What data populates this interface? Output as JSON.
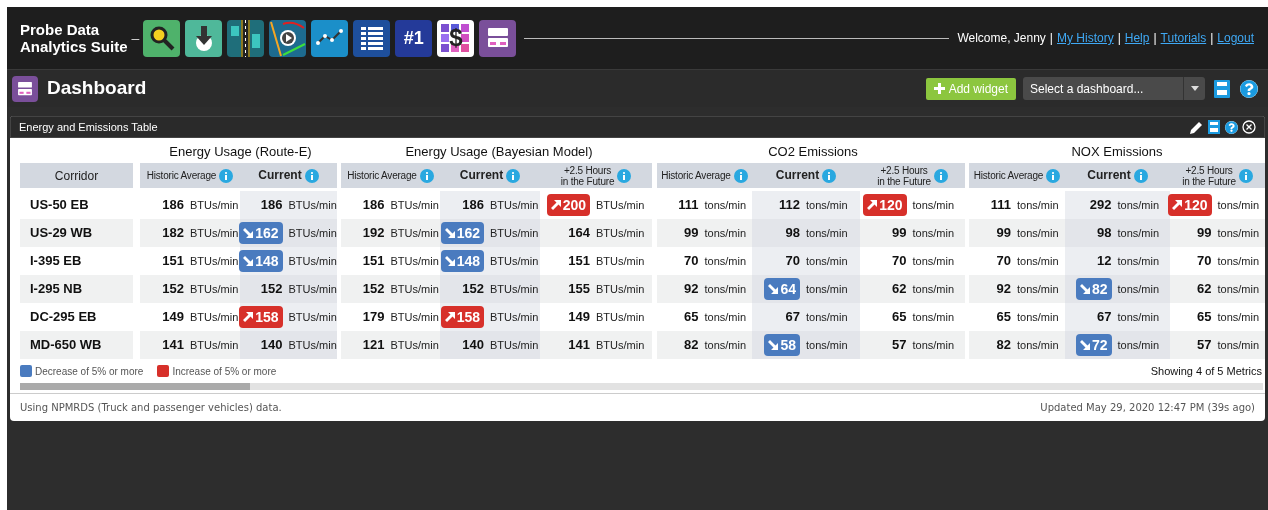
{
  "header": {
    "title_lines": [
      "Probe Data",
      "Analytics Suite"
    ],
    "separator": "–",
    "apps": [
      {
        "kind": "search"
      },
      {
        "kind": "download"
      },
      {
        "kind": "road"
      },
      {
        "kind": "map-play"
      },
      {
        "kind": "line-chart"
      },
      {
        "kind": "list"
      },
      {
        "kind": "rank",
        "label": "#1"
      },
      {
        "kind": "cost",
        "label": "$"
      },
      {
        "kind": "dashboard"
      }
    ],
    "welcome": "Welcome, Jenny",
    "links": [
      "My History",
      "Help",
      "Tutorials",
      "Logout"
    ],
    "link_separator": "|"
  },
  "page_bar": {
    "title": "Dashboard",
    "add_button": "Add widget",
    "select": {
      "placeholder": "Select a dashboard..."
    }
  },
  "widget": {
    "title": "Energy and Emissions Table",
    "corridor_header": "Corridor",
    "groups": [
      {
        "title": "Energy Usage (Route-E)",
        "columns": [
          {
            "lines": [
              "Historic Average"
            ],
            "emphasis": false
          },
          {
            "lines": [
              "Current"
            ],
            "emphasis": true
          }
        ]
      },
      {
        "title": "Energy Usage (Bayesian Model)",
        "columns": [
          {
            "lines": [
              "Historic Average"
            ],
            "emphasis": false
          },
          {
            "lines": [
              "Current"
            ],
            "emphasis": true
          },
          {
            "lines": [
              "+2.5 Hours",
              "in the Future"
            ],
            "emphasis": false
          }
        ]
      },
      {
        "title": "CO2 Emissions",
        "columns": [
          {
            "lines": [
              "Historic Average"
            ],
            "emphasis": false
          },
          {
            "lines": [
              "Current"
            ],
            "emphasis": true
          },
          {
            "lines": [
              "+2.5 Hours",
              "in the Future"
            ],
            "emphasis": false
          }
        ]
      },
      {
        "title": "NOX Emissions",
        "columns": [
          {
            "lines": [
              "Historic Average"
            ],
            "emphasis": false
          },
          {
            "lines": [
              "Current"
            ],
            "emphasis": true
          },
          {
            "lines": [
              "+2.5 Hours",
              "in the Future"
            ],
            "emphasis": false
          }
        ]
      }
    ],
    "rows": [
      {
        "corridor": "US-50 EB",
        "cells": [
          {
            "value": "186",
            "unit": "BTUs/min",
            "kind": "plain"
          },
          {
            "value": "186",
            "unit": "BTUs/min",
            "kind": "plain"
          },
          {
            "value": "186",
            "unit": "BTUs/min",
            "kind": "plain"
          },
          {
            "value": "186",
            "unit": "BTUs/min",
            "kind": "plain"
          },
          {
            "value": "200",
            "unit": "BTUs/min",
            "kind": "up"
          },
          {
            "value": "111",
            "unit": "tons/min",
            "kind": "plain"
          },
          {
            "value": "112",
            "unit": "tons/min",
            "kind": "plain"
          },
          {
            "value": "120",
            "unit": "tons/min",
            "kind": "up"
          },
          {
            "value": "111",
            "unit": "tons/min",
            "kind": "plain"
          },
          {
            "value": "292",
            "unit": "tons/min",
            "kind": "plain"
          },
          {
            "value": "120",
            "unit": "tons/min",
            "kind": "up"
          }
        ]
      },
      {
        "corridor": "US-29 WB",
        "cells": [
          {
            "value": "182",
            "unit": "BTUs/min",
            "kind": "plain"
          },
          {
            "value": "162",
            "unit": "BTUs/min",
            "kind": "down"
          },
          {
            "value": "192",
            "unit": "BTUs/min",
            "kind": "plain"
          },
          {
            "value": "162",
            "unit": "BTUs/min",
            "kind": "down"
          },
          {
            "value": "164",
            "unit": "BTUs/min",
            "kind": "plain"
          },
          {
            "value": "99",
            "unit": "tons/min",
            "kind": "plain"
          },
          {
            "value": "98",
            "unit": "tons/min",
            "kind": "plain"
          },
          {
            "value": "99",
            "unit": "tons/min",
            "kind": "plain"
          },
          {
            "value": "99",
            "unit": "tons/min",
            "kind": "plain"
          },
          {
            "value": "98",
            "unit": "tons/min",
            "kind": "plain"
          },
          {
            "value": "99",
            "unit": "tons/min",
            "kind": "plain"
          }
        ]
      },
      {
        "corridor": "I-395 EB",
        "cells": [
          {
            "value": "151",
            "unit": "BTUs/min",
            "kind": "plain"
          },
          {
            "value": "148",
            "unit": "BTUs/min",
            "kind": "down"
          },
          {
            "value": "151",
            "unit": "BTUs/min",
            "kind": "plain"
          },
          {
            "value": "148",
            "unit": "BTUs/min",
            "kind": "down"
          },
          {
            "value": "151",
            "unit": "BTUs/min",
            "kind": "plain"
          },
          {
            "value": "70",
            "unit": "tons/min",
            "kind": "plain"
          },
          {
            "value": "70",
            "unit": "tons/min",
            "kind": "plain"
          },
          {
            "value": "70",
            "unit": "tons/min",
            "kind": "plain"
          },
          {
            "value": "70",
            "unit": "tons/min",
            "kind": "plain"
          },
          {
            "value": "12",
            "unit": "tons/min",
            "kind": "plain"
          },
          {
            "value": "70",
            "unit": "tons/min",
            "kind": "plain"
          }
        ]
      },
      {
        "corridor": "I-295 NB",
        "cells": [
          {
            "value": "152",
            "unit": "BTUs/min",
            "kind": "plain"
          },
          {
            "value": "152",
            "unit": "BTUs/min",
            "kind": "plain"
          },
          {
            "value": "152",
            "unit": "BTUs/min",
            "kind": "plain"
          },
          {
            "value": "152",
            "unit": "BTUs/min",
            "kind": "plain"
          },
          {
            "value": "155",
            "unit": "BTUs/min",
            "kind": "plain"
          },
          {
            "value": "92",
            "unit": "tons/min",
            "kind": "plain"
          },
          {
            "value": "64",
            "unit": "tons/min",
            "kind": "down"
          },
          {
            "value": "62",
            "unit": "tons/min",
            "kind": "plain"
          },
          {
            "value": "92",
            "unit": "tons/min",
            "kind": "plain"
          },
          {
            "value": "82",
            "unit": "tons/min",
            "kind": "down"
          },
          {
            "value": "62",
            "unit": "tons/min",
            "kind": "plain"
          }
        ]
      },
      {
        "corridor": "DC-295 EB",
        "cells": [
          {
            "value": "149",
            "unit": "BTUs/min",
            "kind": "plain"
          },
          {
            "value": "158",
            "unit": "BTUs/min",
            "kind": "up"
          },
          {
            "value": "179",
            "unit": "BTUs/min",
            "kind": "plain"
          },
          {
            "value": "158",
            "unit": "BTUs/min",
            "kind": "up"
          },
          {
            "value": "149",
            "unit": "BTUs/min",
            "kind": "plain"
          },
          {
            "value": "65",
            "unit": "tons/min",
            "kind": "plain"
          },
          {
            "value": "67",
            "unit": "tons/min",
            "kind": "plain"
          },
          {
            "value": "65",
            "unit": "tons/min",
            "kind": "plain"
          },
          {
            "value": "65",
            "unit": "tons/min",
            "kind": "plain"
          },
          {
            "value": "67",
            "unit": "tons/min",
            "kind": "plain"
          },
          {
            "value": "65",
            "unit": "tons/min",
            "kind": "plain"
          }
        ]
      },
      {
        "corridor": "MD-650 WB",
        "cells": [
          {
            "value": "141",
            "unit": "BTUs/min",
            "kind": "plain"
          },
          {
            "value": "140",
            "unit": "BTUs/min",
            "kind": "plain"
          },
          {
            "value": "121",
            "unit": "BTUs/min",
            "kind": "plain"
          },
          {
            "value": "140",
            "unit": "BTUs/min",
            "kind": "plain"
          },
          {
            "value": "141",
            "unit": "BTUs/min",
            "kind": "plain"
          },
          {
            "value": "82",
            "unit": "tons/min",
            "kind": "plain"
          },
          {
            "value": "58",
            "unit": "tons/min",
            "kind": "down"
          },
          {
            "value": "57",
            "unit": "tons/min",
            "kind": "plain"
          },
          {
            "value": "82",
            "unit": "tons/min",
            "kind": "plain"
          },
          {
            "value": "72",
            "unit": "tons/min",
            "kind": "down"
          },
          {
            "value": "57",
            "unit": "tons/min",
            "kind": "plain"
          }
        ]
      }
    ],
    "legend": [
      {
        "label": "Decrease of 5% or more",
        "color": "#4a7bbf"
      },
      {
        "label": "Increase of 5% or more",
        "color": "#d7302a"
      }
    ],
    "metrics_note": "Showing 4 of 5 Metrics",
    "source_note": "Using NPMRDS (Truck and passenger vehicles) data.",
    "updated": "Updated May 29, 2020 12:47 PM (39s ago)"
  }
}
